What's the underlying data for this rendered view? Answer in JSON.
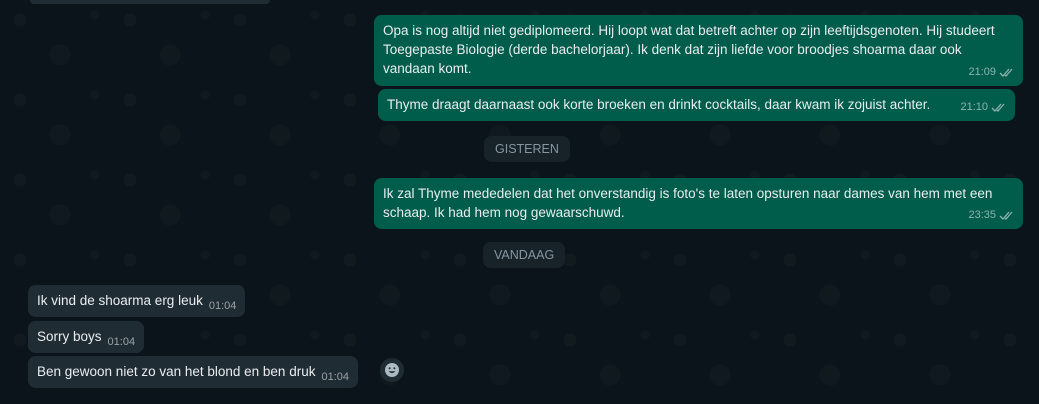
{
  "messages": {
    "out1": {
      "text": "Opa is nog altijd niet gediplomeerd. Hij loopt wat dat betreft achter op zijn leeftijdsgenoten. Hij studeert Toegepaste Biologie (derde bachelorjaar). Ik denk dat zijn liefde voor broodjes shoarma daar ook vandaan komt.",
      "time": "21:09"
    },
    "out2": {
      "text": "Thyme draagt daarnaast ook korte broeken en drinkt cocktails, daar kwam ik zojuist achter.",
      "time": "21:10"
    },
    "out3": {
      "text": "Ik zal Thyme mededelen dat het onverstandig is foto's te laten opsturen naar dames van hem met een schaap. Ik had hem nog gewaarschuwd.",
      "time": "23:35"
    },
    "in1": {
      "text": "Ik vind de shoarma erg leuk",
      "time": "01:04"
    },
    "in2": {
      "text": "Sorry boys",
      "time": "01:04"
    },
    "in3": {
      "text": "Ben gewoon niet zo van het blond en ben druk",
      "time": "01:04"
    }
  },
  "dates": {
    "yesterday": "GISTEREN",
    "today": "VANDAAG"
  },
  "icons": {
    "read_receipt": "double-check-icon",
    "reaction": "smiley-icon"
  },
  "colors": {
    "background": "#0b141a",
    "outgoing_bubble": "#005c4b",
    "incoming_bubble": "#202c33",
    "text": "#e9edef",
    "meta": "#8696a0"
  }
}
